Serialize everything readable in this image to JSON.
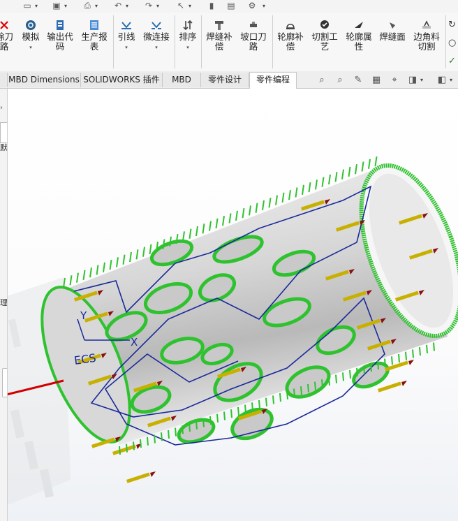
{
  "ribbon": {
    "items": [
      {
        "label": "除刀\n路",
        "icon": "toolpath-delete-icon"
      },
      {
        "label": "模拟",
        "icon": "simulate-icon"
      },
      {
        "label": "输出代\n码",
        "icon": "output-code-icon"
      },
      {
        "label": "生产报\n表",
        "icon": "report-icon"
      },
      {
        "label": "引线",
        "icon": "lead-line-icon"
      },
      {
        "label": "微连接",
        "icon": "micro-joint-icon"
      },
      {
        "label": "排序",
        "icon": "sort-icon"
      },
      {
        "label": "焊缝补\n偿",
        "icon": "weld-compensation-icon"
      },
      {
        "label": "坡口刀\n路",
        "icon": "bevel-toolpath-icon"
      },
      {
        "label": "轮廓补\n偿",
        "icon": "contour-compensation-icon"
      },
      {
        "label": "切割工\n艺",
        "icon": "cutting-process-icon"
      },
      {
        "label": "轮廓属\n性",
        "icon": "contour-properties-icon"
      },
      {
        "label": "焊缝面",
        "icon": "weld-face-icon"
      },
      {
        "label": "边角料\n切割",
        "icon": "scrap-cut-icon"
      }
    ]
  },
  "tabs": [
    {
      "label": "MBD Dimensions"
    },
    {
      "label": "SOLIDWORKS 插件"
    },
    {
      "label": "MBD"
    },
    {
      "label": "零件设计"
    },
    {
      "label": "零件编程"
    }
  ],
  "left_panel": {
    "text1": "默",
    "text2": "理,"
  },
  "canvas": {
    "triad": {
      "y": "Y",
      "x": "X",
      "origin": "ECS"
    },
    "colors": {
      "toolpath": "#2fc22f",
      "path_blue": "#1a2a9a",
      "axis_red": "#d00000",
      "lead": "#c8b000",
      "tube": "#c8c8c8"
    }
  }
}
